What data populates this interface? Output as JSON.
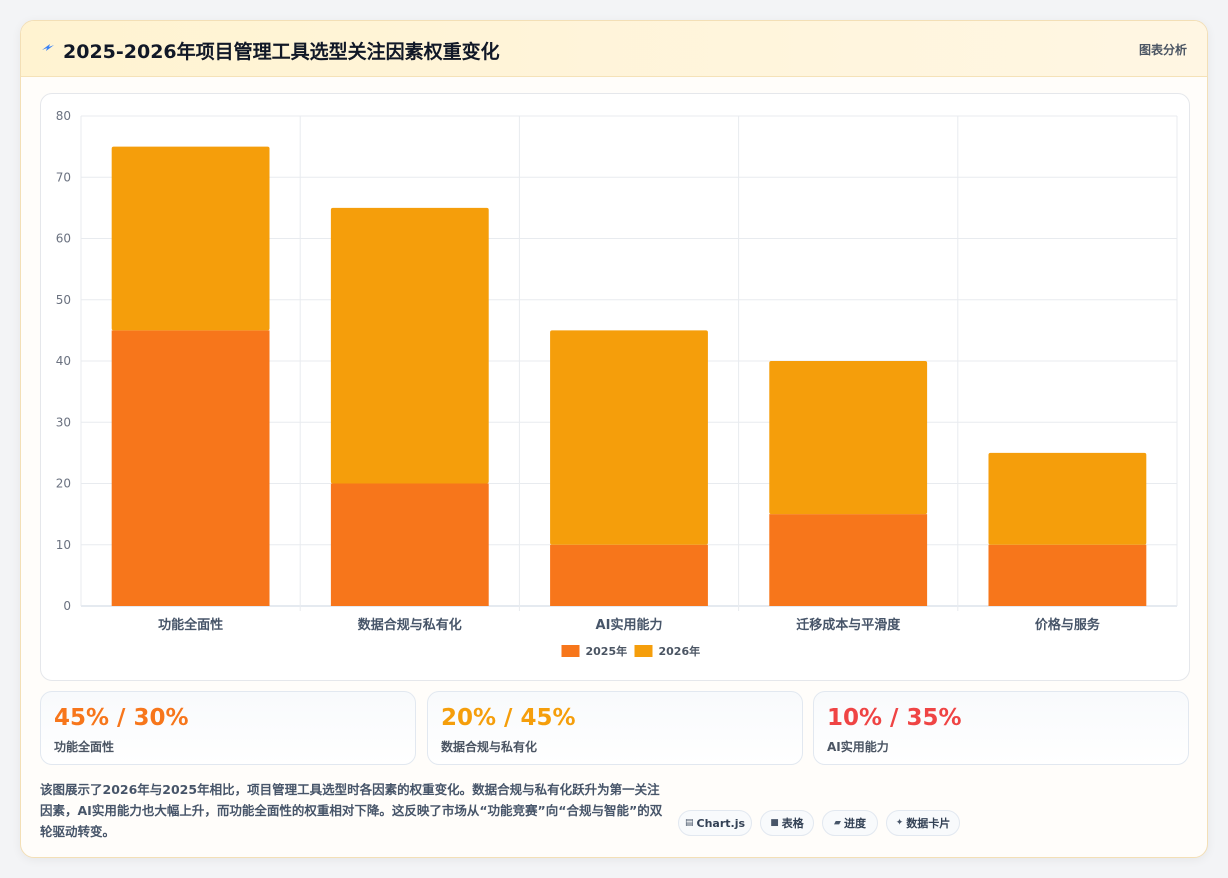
{
  "header": {
    "icon": "sparkle-icon",
    "title": "2025-2026年项目管理工具选型关注因素权重变化",
    "tag": "图表分析"
  },
  "chart_data": {
    "type": "bar",
    "stacked": true,
    "categories": [
      "功能全面性",
      "数据合规与私有化",
      "AI实用能力",
      "迁移成本与平滑度",
      "价格与服务"
    ],
    "series": [
      {
        "name": "2025年",
        "values": [
          45,
          20,
          10,
          15,
          10
        ],
        "color": "#f7761b"
      },
      {
        "name": "2026年",
        "values": [
          30,
          45,
          35,
          25,
          15
        ],
        "color": "#f59e0b"
      }
    ],
    "ylim": [
      0,
      80
    ],
    "yticks": [
      0,
      10,
      20,
      30,
      40,
      50,
      60,
      70,
      80
    ],
    "grid": true,
    "legend": "bottom"
  },
  "stats": [
    {
      "value": "45% / 30%",
      "label": "功能全面性",
      "color": "#f7761b"
    },
    {
      "value": "20% / 45%",
      "label": "数据合规与私有化",
      "color": "#f59e0b"
    },
    {
      "value": "10% / 35%",
      "label": "AI实用能力",
      "color": "#ef4444"
    }
  ],
  "description": "该图展示了2026年与2025年相比，项目管理工具选型时各因素的权重变化。数据合规与私有化跃升为第一关注因素，AI实用能力也大幅上升，而功能全面性的权重相对下降。这反映了市场从“功能竞赛”向“合规与智能”的双轮驱动转变。",
  "pills": [
    {
      "icon": "chart-icon",
      "glyph": "▤",
      "label": "Chart.js"
    },
    {
      "icon": "table-icon",
      "glyph": "■",
      "label": "表格"
    },
    {
      "icon": "progress-icon",
      "glyph": "▰",
      "label": "进度"
    },
    {
      "icon": "card-icon",
      "glyph": "✦",
      "label": "数据卡片"
    }
  ]
}
